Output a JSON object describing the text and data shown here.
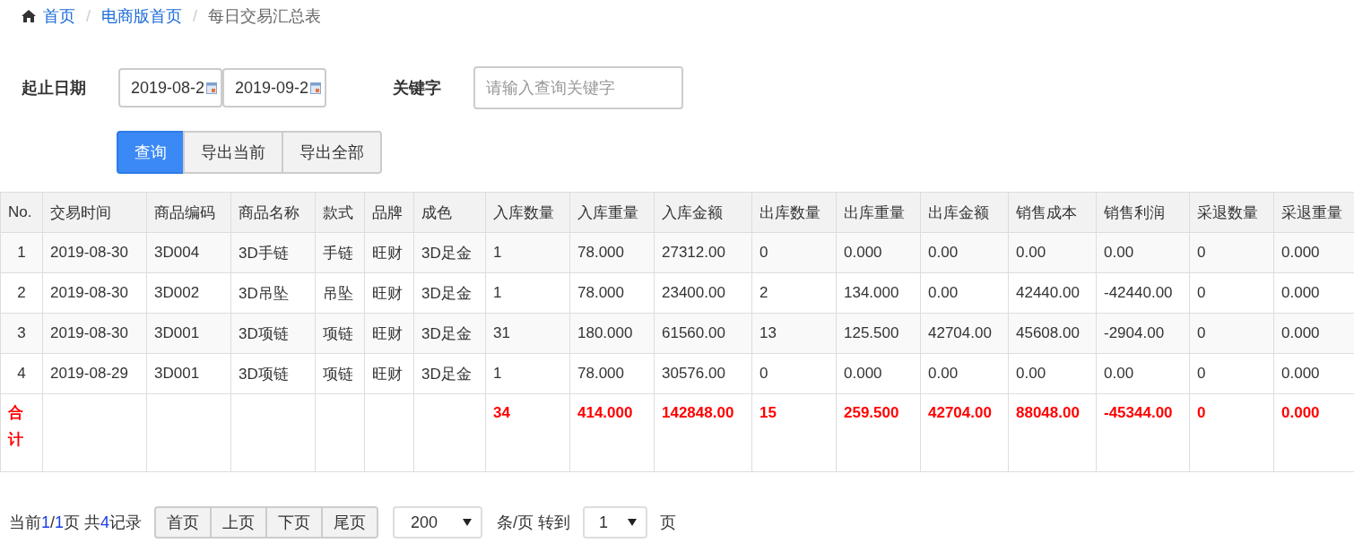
{
  "breadcrumb": [
    {
      "label": "首页",
      "link": true
    },
    {
      "label": "电商版首页",
      "link": true
    },
    {
      "label": "每日交易汇总表",
      "link": false
    }
  ],
  "filters": {
    "date_label": "起止日期",
    "date_from": "2019-08-2",
    "date_to": "2019-09-2",
    "keyword_label": "关键字",
    "keyword_placeholder": "请输入查询关键字"
  },
  "actions": [
    {
      "label": "查询",
      "primary": true
    },
    {
      "label": "导出当前",
      "primary": false
    },
    {
      "label": "导出全部",
      "primary": false
    }
  ],
  "table": {
    "columns": [
      "No.",
      "交易时间",
      "商品编码",
      "商品名称",
      "款式",
      "品牌",
      "成色",
      "入库数量",
      "入库重量",
      "入库金额",
      "出库数量",
      "出库重量",
      "出库金额",
      "销售成本",
      "销售利润",
      "采退数量",
      "采退重量"
    ],
    "rows": [
      [
        "1",
        "2019-08-30",
        "3D004",
        "3D手链",
        "手链",
        "旺财",
        "3D足金",
        "1",
        "78.000",
        "27312.00",
        "0",
        "0.000",
        "0.00",
        "0.00",
        "0.00",
        "0",
        "0.000"
      ],
      [
        "2",
        "2019-08-30",
        "3D002",
        "3D吊坠",
        "吊坠",
        "旺财",
        "3D足金",
        "1",
        "78.000",
        "23400.00",
        "2",
        "134.000",
        "0.00",
        "42440.00",
        "-42440.00",
        "0",
        "0.000"
      ],
      [
        "3",
        "2019-08-30",
        "3D001",
        "3D项链",
        "项链",
        "旺财",
        "3D足金",
        "31",
        "180.000",
        "61560.00",
        "13",
        "125.500",
        "42704.00",
        "45608.00",
        "-2904.00",
        "0",
        "0.000"
      ],
      [
        "4",
        "2019-08-29",
        "3D001",
        "3D项链",
        "项链",
        "旺财",
        "3D足金",
        "1",
        "78.000",
        "30576.00",
        "0",
        "0.000",
        "0.00",
        "0.00",
        "0.00",
        "0",
        "0.000"
      ]
    ],
    "total": {
      "label": "合计",
      "values": [
        "34",
        "414.000",
        "142848.00",
        "15",
        "259.500",
        "42704.00",
        "88048.00",
        "-45344.00",
        "0",
        "0.000"
      ]
    }
  },
  "breadcrumb_separator": "/",
  "pager": {
    "prefix": "当前",
    "current_page": "1",
    "separator": "/",
    "total_pages": "1",
    "middle": "页 共",
    "record_count": "4",
    "suffix": "记录",
    "buttons": [
      "首页",
      "上页",
      "下页",
      "尾页"
    ],
    "page_size": "200",
    "page_size_label": "条/页 转到",
    "goto_page": "1",
    "page_label": "页"
  }
}
